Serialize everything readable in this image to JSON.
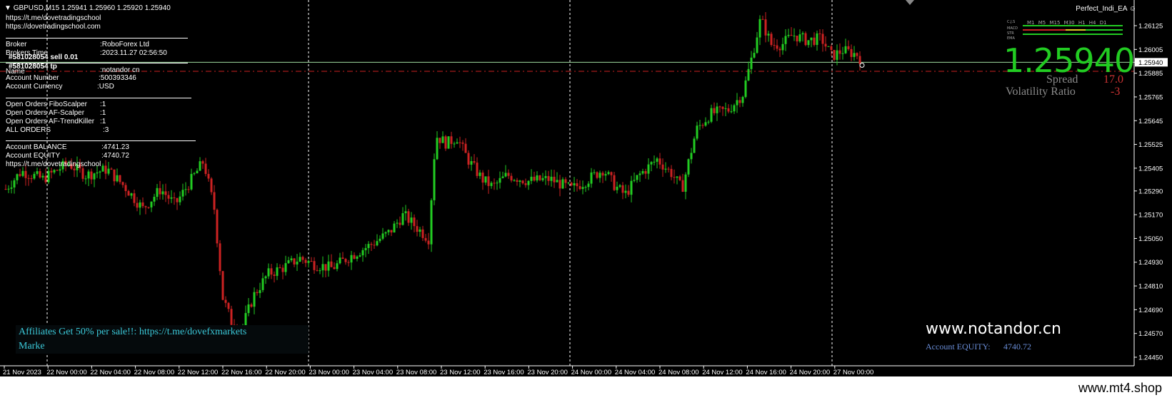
{
  "chart": {
    "header": "GBPUSD,M15  1.25941 1.25960 1.25920 1.25940",
    "ea_name": "Perfect_Indi_EA",
    "price_levels": [
      "1.26125",
      "1.26005",
      "1.25940",
      "1.25885",
      "1.25765",
      "1.25645",
      "1.25525",
      "1.25405",
      "1.25290",
      "1.25170",
      "1.25050",
      "1.24930",
      "1.24810",
      "1.24690",
      "1.24570",
      "1.24450"
    ],
    "current_price_label": "1.25940",
    "time_labels": [
      "21 Nov 2023",
      "22 Nov 00:00",
      "22 Nov 04:00",
      "22 Nov 08:00",
      "22 Nov 12:00",
      "22 Nov 16:00",
      "22 Nov 20:00",
      "23 Nov 00:00",
      "23 Nov 04:00",
      "23 Nov 08:00",
      "23 Nov 12:00",
      "23 Nov 16:00",
      "23 Nov 20:00",
      "24 Nov 00:00",
      "24 Nov 04:00",
      "24 Nov 08:00",
      "24 Nov 12:00",
      "24 Nov 16:00",
      "24 Nov 20:00",
      "27 Nov 00:00"
    ],
    "colors": {
      "bull": "#22cc22",
      "bear": "#cc2222",
      "background": "#000000",
      "grid": "#ffffff"
    }
  },
  "info_panel": {
    "link1": "https://t.me/dovetradingschool",
    "link2": "https://dovetradingschool.com",
    "broker_label": "Broker",
    "broker_value": ":RoboForex Ltd",
    "broker_time_label": "Brokers Time",
    "broker_time_value": ":2023.11.27 02:56:50",
    "order_sell": "#581028054 sell 0.01",
    "order_tp": "#581028054 tp",
    "name_label": "Name",
    "name_value": ":notandor cn",
    "account_number_label": "Account Number",
    "account_number_value": ":500393346",
    "account_currency_label": "Account Currency",
    "account_currency_value": ":USD",
    "open_orders": [
      {
        "label": "Open Orders FiboScalper",
        "value": ":1"
      },
      {
        "label": "Open Orders AF-Scalper",
        "value": ":1"
      },
      {
        "label": "Open Orders AF-TrendKiller",
        "value": ":1"
      },
      {
        "label": "ALL ORDERS",
        "value": ":3"
      }
    ],
    "balance_label": "Account BALANCE",
    "balance_value": ":4741.23",
    "equity_label": "Account EQUITY",
    "equity_value": ":4740.72",
    "link3": "https://t.me/dovetradingschool"
  },
  "right_panel": {
    "big_price": "1.25940",
    "spread_label": "Spread",
    "spread_value": "17.0",
    "volatility_label": "Volatility Ratio",
    "volatility_value": "-3",
    "tf_labels": [
      "M1",
      "M5",
      "M15",
      "M30",
      "H1",
      "H4",
      "D1"
    ],
    "row_labels": [
      "C.J.S",
      "MACD",
      "STR",
      "EMA"
    ]
  },
  "bottom_overlay": {
    "affiliate_line": "Affiliates Get 50% per sale!!: https://t.me/dovefxmarkets",
    "market_line": "Marke",
    "watermark": "www.notandor.cn",
    "equity_label": "Account EQUITY:",
    "equity_value": "4740.72"
  },
  "footer": {
    "watermark": "www.mt4.shop"
  }
}
